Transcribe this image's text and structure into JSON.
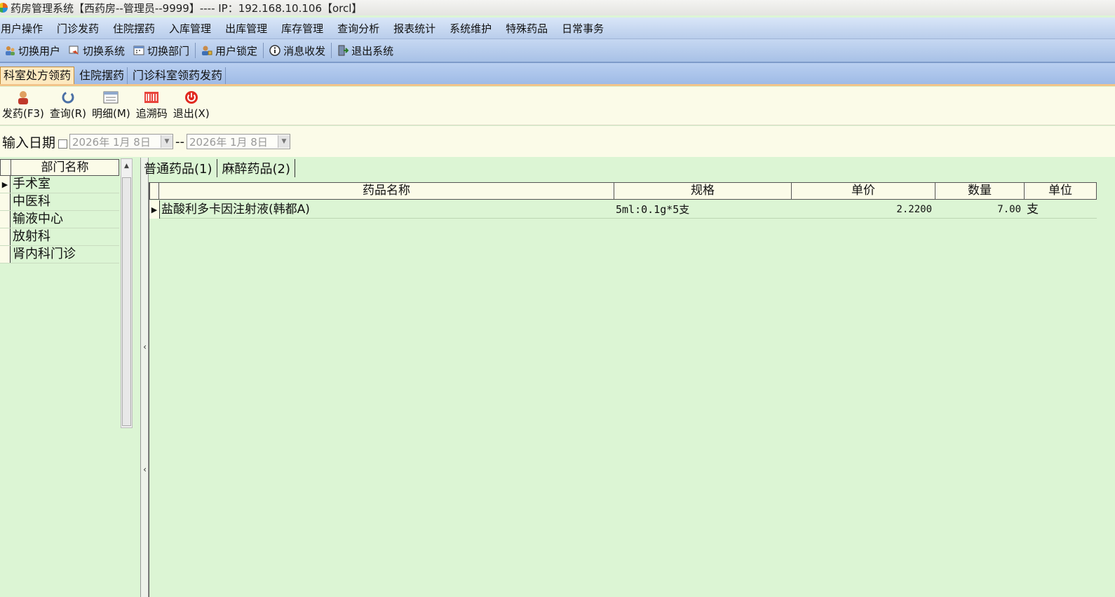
{
  "window": {
    "title": "药房管理系统【西药房--管理员--9999】---- IP：192.168.10.106【orcl】"
  },
  "menu": [
    "用户操作",
    "门诊发药",
    "住院摆药",
    "入库管理",
    "出库管理",
    "库存管理",
    "查询分析",
    "报表统计",
    "系统维护",
    "特殊药品",
    "日常事务"
  ],
  "toolbar": {
    "switch_user": "切换用户",
    "switch_system": "切换系统",
    "switch_dept": "切换部门",
    "lock_user": "用户锁定",
    "messages": "消息收发",
    "exit_system": "退出系统"
  },
  "tabs": [
    "科室处方领药",
    "住院摆药",
    "门诊科室领药发药"
  ],
  "actions": {
    "dispense": "发药(F3)",
    "query": "查询(R)",
    "detail": "明细(M)",
    "trace_code": "追溯码",
    "exit": "退出(X)"
  },
  "filter": {
    "label": "输入日期",
    "date_from": "2026年 1月 8日",
    "date_to": "2026年 1月 8日",
    "separator": "--"
  },
  "departments": {
    "header": "部门名称",
    "items": [
      "手术室",
      "中医科",
      "输液中心",
      "放射科",
      "肾内科门诊"
    ]
  },
  "drug_tabs": [
    "普通药品(1)",
    "麻醉药品(2)"
  ],
  "grid": {
    "columns": [
      "药品名称",
      "规格",
      "单价",
      "数量",
      "单位"
    ],
    "rows": [
      {
        "name": "盐酸利多卡因注射液(韩都A)",
        "spec": "5ml:0.1g*5支",
        "price": "2.2200",
        "qty": "7.00",
        "unit": "支"
      }
    ]
  },
  "colors": {
    "body_bg": "#dcf5d4",
    "panel_bg": "#fbfbe8",
    "menu_bg": "#c6d8f2",
    "active_tab": "#fde9c0"
  }
}
